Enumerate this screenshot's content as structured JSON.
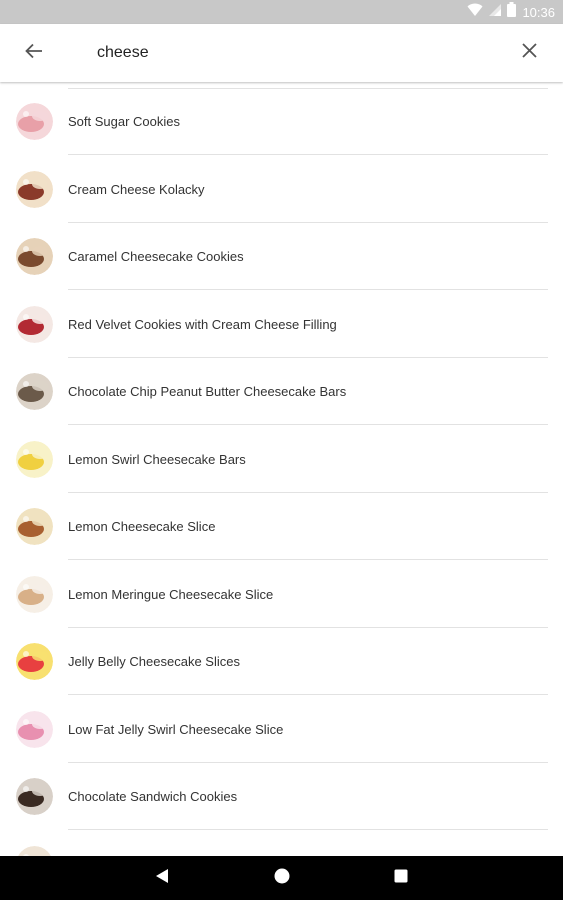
{
  "status_bar": {
    "time": "10:36",
    "icons": [
      "wifi-icon",
      "cell-signal-icon",
      "battery-icon"
    ]
  },
  "search": {
    "query": "cheese",
    "back_icon": "arrow-left-icon",
    "clear_icon": "close-icon"
  },
  "results": [
    {
      "title": "Soft Sugar Cookies",
      "thumb_colors": [
        "#e8a0a8",
        "#f5d7da"
      ]
    },
    {
      "title": "Cream Cheese Kolacky",
      "thumb_colors": [
        "#8a3a2a",
        "#f1e0c8"
      ]
    },
    {
      "title": "Caramel Cheesecake Cookies",
      "thumb_colors": [
        "#7a4a2e",
        "#e6d2b8"
      ]
    },
    {
      "title": "Red Velvet Cookies with Cream Cheese Filling",
      "thumb_colors": [
        "#b22a33",
        "#f4e8e4"
      ]
    },
    {
      "title": "Chocolate Chip Peanut Butter Cheesecake Bars",
      "thumb_colors": [
        "#6b5a4a",
        "#dcd3c8"
      ]
    },
    {
      "title": "Lemon Swirl Cheesecake Bars",
      "thumb_colors": [
        "#f0d040",
        "#f8f2c8"
      ]
    },
    {
      "title": "Lemon Cheesecake Slice",
      "thumb_colors": [
        "#a86030",
        "#f0e2c0"
      ]
    },
    {
      "title": "Lemon Meringue Cheesecake Slice",
      "thumb_colors": [
        "#d8b088",
        "#f6efe6"
      ]
    },
    {
      "title": "Jelly Belly Cheesecake Slices",
      "thumb_colors": [
        "#e84040",
        "#f8e070"
      ]
    },
    {
      "title": "Low Fat Jelly Swirl Cheesecake Slice",
      "thumb_colors": [
        "#e890b0",
        "#f8e4ec"
      ]
    },
    {
      "title": "Chocolate Sandwich Cookies",
      "thumb_colors": [
        "#3a2a22",
        "#d8d0c8"
      ]
    }
  ],
  "nav_bar": {
    "icons": [
      "back-triangle-icon",
      "home-circle-icon",
      "recents-square-icon"
    ]
  }
}
